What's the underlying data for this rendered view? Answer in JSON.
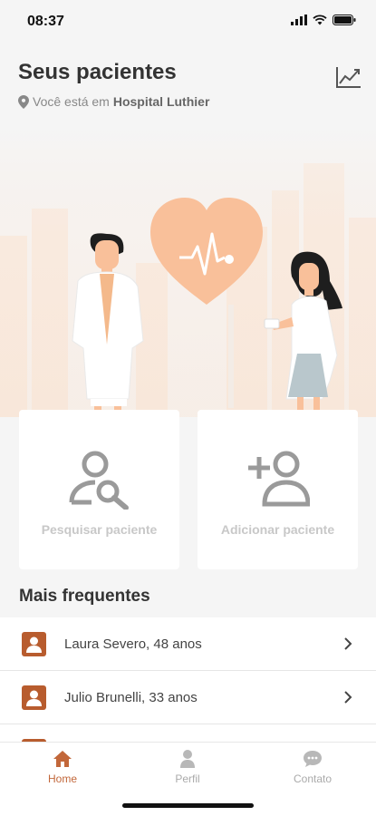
{
  "status": {
    "time": "08:37"
  },
  "header": {
    "title": "Seus pacientes",
    "location_prefix": "Você está em",
    "location_name": "Hospital Luthier"
  },
  "actions": {
    "search_label": "Pesquisar paciente",
    "add_label": "Adicionar paciente"
  },
  "section": {
    "title": "Mais frequentes"
  },
  "patients": [
    {
      "label": "Laura Severo, 48 anos"
    },
    {
      "label": "Julio Brunelli, 33 anos"
    }
  ],
  "tabs": [
    {
      "label": "Home",
      "icon": "home-icon",
      "active": true
    },
    {
      "label": "Perfil",
      "icon": "user-icon",
      "active": false
    },
    {
      "label": "Contato",
      "icon": "chat-icon",
      "active": false
    }
  ],
  "colors": {
    "accent": "#c2673a",
    "avatar": "#b85c2e",
    "heart": "#f9c09a",
    "background": "#f5f5f5"
  }
}
